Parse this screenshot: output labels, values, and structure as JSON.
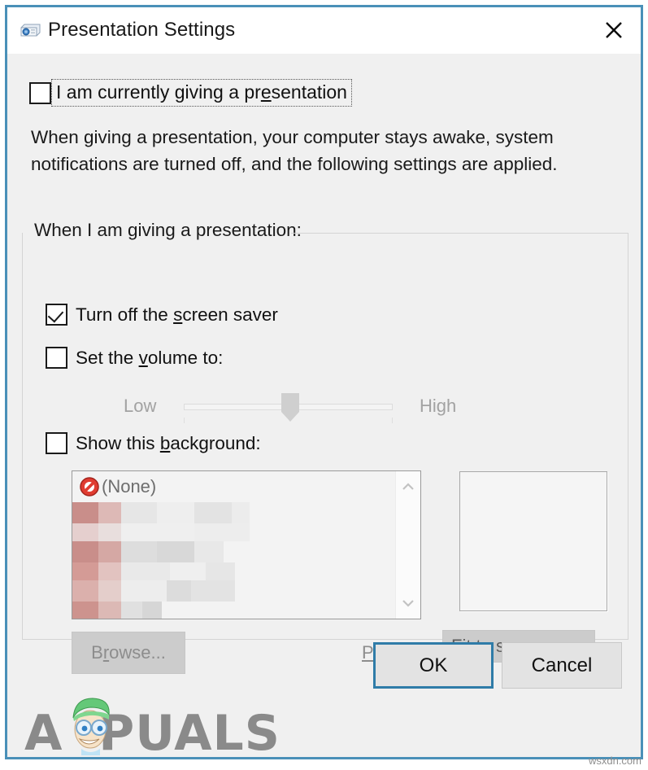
{
  "window": {
    "title": "Presentation Settings",
    "icon": "projector-icon",
    "close_label": "✕",
    "border_color": "#4a90b8"
  },
  "top_checkbox": {
    "label_before": "I am currently giving a pr",
    "label_accel": "e",
    "label_after": "sentation",
    "full_label": "I am currently giving a presentation",
    "checked": false,
    "focused": true
  },
  "description": "When giving a presentation, your computer stays awake, system notifications are turned off, and the following settings are applied.",
  "group": {
    "title": "When I am giving a presentation:",
    "screensaver": {
      "label_before": "Turn off the ",
      "label_accel": "s",
      "label_after": "creen saver",
      "full_label": "Turn off the screen saver",
      "checked": true
    },
    "volume": {
      "label_before": "Set the ",
      "label_accel": "v",
      "label_after": "olume to:",
      "full_label": "Set the volume to:",
      "checked": false,
      "low_label": "Low",
      "high_label": "High",
      "value_percent": 47,
      "disabled": true
    },
    "background": {
      "label_before": "Show this ",
      "label_accel": "b",
      "label_after": "ackground:",
      "full_label": "Show this background:",
      "checked": false,
      "list_items": [
        {
          "label": "(None)",
          "icon": "no-entry-icon",
          "selected": false,
          "censored": false
        }
      ],
      "censored_rows": 6,
      "scrollbar": {
        "up_icon": "chevron-up-icon",
        "down_icon": "chevron-down-icon"
      }
    },
    "browse_button": {
      "label": "Browse...",
      "accel": "r",
      "disabled": true
    },
    "position": {
      "label_before": "",
      "label_accel": "P",
      "label_after": "osition:",
      "full_label": "Position:",
      "selected_value": "Fit to screen",
      "disabled": true,
      "chevron": "chevron-down-icon"
    }
  },
  "footer": {
    "ok_label": "OK",
    "ok_is_default": true,
    "cancel_label": "Cancel"
  },
  "watermarks": {
    "brand": "APPUALS",
    "brand_prefix": "A",
    "brand_suffix": "PUALS",
    "site": "wsxdn.com"
  }
}
